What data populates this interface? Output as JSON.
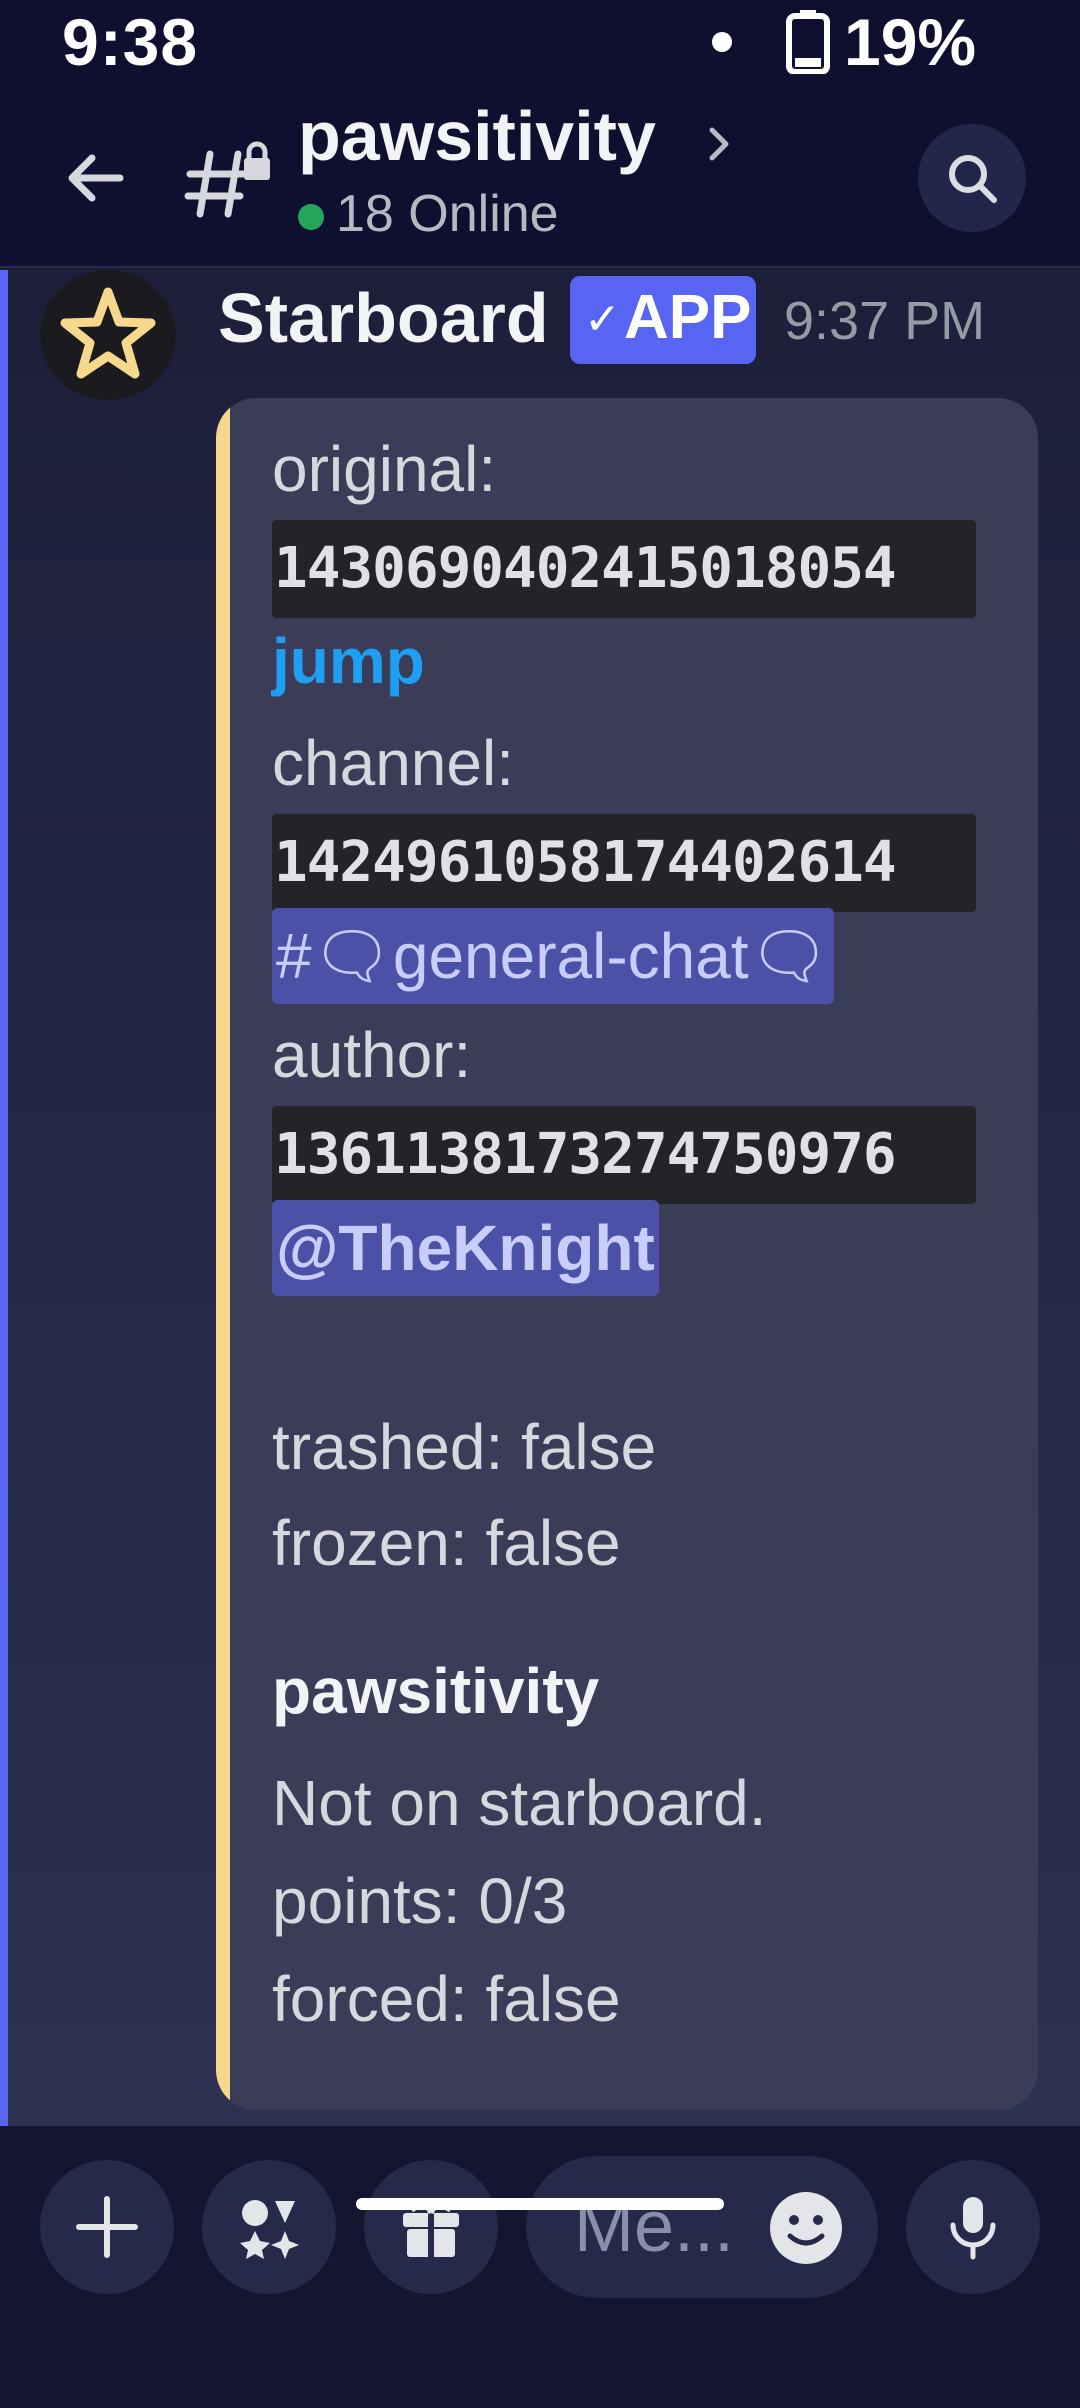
{
  "status_bar": {
    "time": "9:38",
    "battery": "19%"
  },
  "header": {
    "channel_name": "pawsitivity",
    "online_count": "18 Online",
    "online_color": "#23a55a"
  },
  "message": {
    "author": "Starboard",
    "badge_check": "✓",
    "badge_text": "APP",
    "timestamp": "9:37 PM",
    "embed": {
      "accent_color": "#f6d88c",
      "original_label": "original:",
      "original_id": "1430690402415018054",
      "jump_link": "jump",
      "channel_label": "channel:",
      "channel_id": "1424961058174402614",
      "channel_mention": "#🗨general-chat🗨",
      "author_label": "author:",
      "author_id": "1361138173274750976",
      "author_mention": "@TheKnight",
      "trashed": "trashed: false",
      "frozen": "frozen: false",
      "section_title": "pawsitivity",
      "status": "Not on starboard.",
      "points": "points: 0/3",
      "forced": "forced: false"
    }
  },
  "composer": {
    "placeholder": "Me..."
  },
  "icons": {
    "back": "arrow-left-icon",
    "channel": "locked-text-channel-icon",
    "search": "search-icon",
    "add": "plus-icon",
    "apps": "apps-icon",
    "gift": "gift-icon",
    "emoji": "emoji-icon",
    "mic": "microphone-icon"
  },
  "colors": {
    "brand": "#5865f2",
    "link": "#1e9ff2",
    "mention_bg": "#4a51a6"
  }
}
